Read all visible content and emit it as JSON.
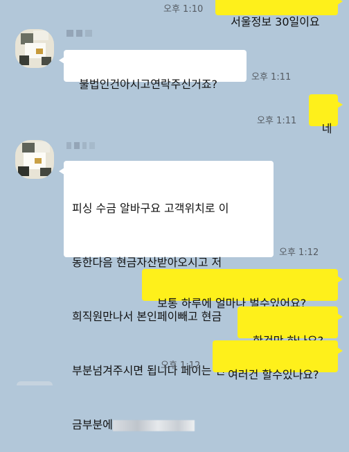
{
  "messages": [
    {
      "side": "me",
      "text": "서울정보 30일이요",
      "time": "오후 1:10"
    },
    {
      "side": "them",
      "text": "불법인건아시고연락주신거죠?",
      "time": "오후 1:11"
    },
    {
      "side": "me",
      "text": "네",
      "time": "오후 1:11"
    },
    {
      "side": "them",
      "text_lines": [
        "피싱 수금 알바구요 고객위치로 이",
        "동한다음 현금자산받아오시고 저",
        "희직원만나서 본인페이빼고 현금",
        "부분넘겨주시면 됩니다 페이는 현",
        "금부분에"
      ],
      "time": "오후 1:12"
    },
    {
      "side": "me",
      "text": "보통 하루에 얼마나 벌수있어요?"
    },
    {
      "side": "me",
      "text": "한건만 하나요?"
    },
    {
      "side": "me",
      "text": "여러건 할수있나요?",
      "time": "오후 1:12"
    }
  ],
  "colors": {
    "background": "#b2c7d9",
    "my_bubble": "#fef01b",
    "their_bubble": "#ffffff",
    "timestamp": "#555b62"
  }
}
